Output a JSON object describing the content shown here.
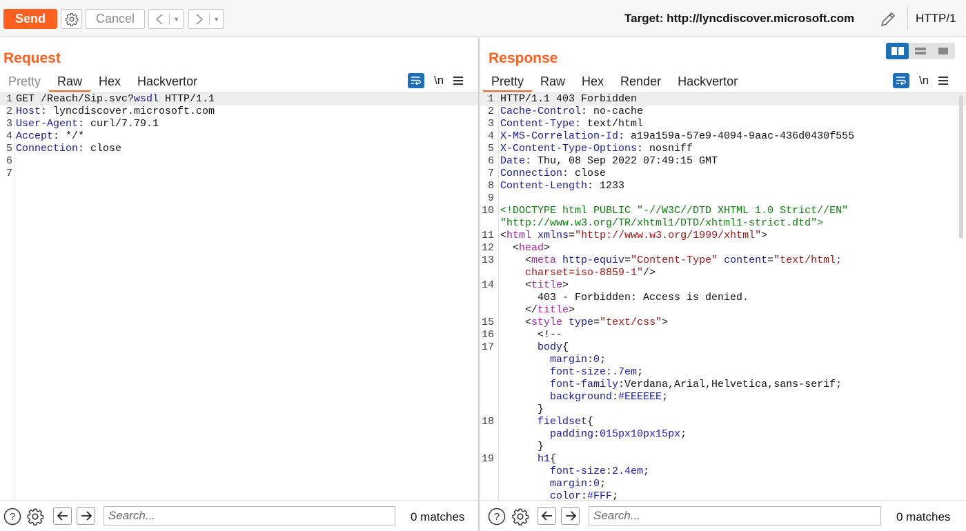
{
  "toolbar": {
    "send_label": "Send",
    "cancel_label": "Cancel",
    "target_label": "Target: http://lyncdiscover.microsoft.com",
    "protocol_label": "HTTP/1"
  },
  "request": {
    "title": "Request",
    "tabs": [
      "Pretty",
      "Raw",
      "Hex",
      "Hackvertor"
    ],
    "active_tab": "Raw",
    "newline_label": "\\n",
    "lines": [
      {
        "n": "1",
        "parts": [
          [
            "v",
            "GET /Reach/Sip.svc?"
          ],
          [
            "k",
            "wsdl"
          ],
          [
            "v",
            " HTTP/1.1"
          ]
        ]
      },
      {
        "n": "2",
        "parts": [
          [
            "k",
            "Host"
          ],
          [
            "v",
            ": lyncdiscover.microsoft.com"
          ]
        ]
      },
      {
        "n": "3",
        "parts": [
          [
            "k",
            "User-Agent"
          ],
          [
            "v",
            ": curl/7.79.1"
          ]
        ]
      },
      {
        "n": "4",
        "parts": [
          [
            "k",
            "Accept"
          ],
          [
            "v",
            ": */*"
          ]
        ]
      },
      {
        "n": "5",
        "parts": [
          [
            "k",
            "Connection"
          ],
          [
            "v",
            ": close"
          ]
        ]
      },
      {
        "n": "6",
        "parts": []
      },
      {
        "n": "7",
        "parts": []
      }
    ],
    "search": {
      "placeholder": "Search...",
      "matches": "0 matches"
    }
  },
  "response": {
    "title": "Response",
    "tabs": [
      "Pretty",
      "Raw",
      "Hex",
      "Render",
      "Hackvertor"
    ],
    "active_tab": "Pretty",
    "newline_label": "\\n",
    "lines": [
      {
        "n": "1",
        "parts": [
          [
            "v",
            "HTTP/1.1 403 Forbidden"
          ]
        ]
      },
      {
        "n": "2",
        "parts": [
          [
            "k",
            "Cache-Control"
          ],
          [
            "v",
            ": no-cache"
          ]
        ]
      },
      {
        "n": "3",
        "parts": [
          [
            "k",
            "Content-Type"
          ],
          [
            "v",
            ": text/html"
          ]
        ]
      },
      {
        "n": "4",
        "parts": [
          [
            "k",
            "X-MS-Correlation-Id"
          ],
          [
            "v",
            ": a19a159a-57e9-4094-9aac-436d0430f555"
          ]
        ]
      },
      {
        "n": "5",
        "parts": [
          [
            "k",
            "X-Content-Type-Options"
          ],
          [
            "v",
            ": nosniff"
          ]
        ]
      },
      {
        "n": "6",
        "parts": [
          [
            "k",
            "Date"
          ],
          [
            "v",
            ": Thu, 08 Sep 2022 07:49:15 GMT"
          ]
        ]
      },
      {
        "n": "7",
        "parts": [
          [
            "k",
            "Connection"
          ],
          [
            "v",
            ": close"
          ]
        ]
      },
      {
        "n": "8",
        "parts": [
          [
            "k",
            "Content-Length"
          ],
          [
            "v",
            ": 1233"
          ]
        ]
      },
      {
        "n": "9",
        "parts": []
      },
      {
        "n": "10",
        "parts": [
          [
            "doctype",
            "<!DOCTYPE html PUBLIC \"-//W3C//DTD XHTML 1.0 Strict//EN\""
          ]
        ]
      },
      {
        "n": "",
        "parts": [
          [
            "doctype",
            "\"http://www.w3.org/TR/xhtml1/DTD/xhtml1-strict.dtd\">"
          ]
        ]
      },
      {
        "n": "11",
        "parts": [
          [
            "tagp",
            "<"
          ],
          [
            "tag",
            "html"
          ],
          [
            "tagp",
            " "
          ],
          [
            "attr",
            "xmlns"
          ],
          [
            "tagp",
            "="
          ],
          [
            "str",
            "\"http://www.w3.org/1999/xhtml\""
          ],
          [
            "tagp",
            ">"
          ]
        ]
      },
      {
        "n": "12",
        "parts": [
          [
            "tagp",
            "  <"
          ],
          [
            "tag",
            "head"
          ],
          [
            "tagp",
            ">"
          ]
        ]
      },
      {
        "n": "13",
        "parts": [
          [
            "tagp",
            "    <"
          ],
          [
            "tag",
            "meta"
          ],
          [
            "tagp",
            " "
          ],
          [
            "attr",
            "http-equiv"
          ],
          [
            "tagp",
            "="
          ],
          [
            "str",
            "\"Content-Type\""
          ],
          [
            "tagp",
            " "
          ],
          [
            "attr",
            "content"
          ],
          [
            "tagp",
            "="
          ],
          [
            "str",
            "\"text/html;"
          ]
        ]
      },
      {
        "n": "",
        "parts": [
          [
            "str",
            "    charset=iso-8859-1\""
          ],
          [
            "tagp",
            "/>"
          ]
        ]
      },
      {
        "n": "14",
        "parts": [
          [
            "tagp",
            "    <"
          ],
          [
            "tag",
            "title"
          ],
          [
            "tagp",
            ">"
          ]
        ]
      },
      {
        "n": "",
        "parts": [
          [
            "v",
            "      403 - Forbidden: Access is denied."
          ]
        ]
      },
      {
        "n": "",
        "parts": [
          [
            "tagp",
            "    </"
          ],
          [
            "tag",
            "title"
          ],
          [
            "tagp",
            ">"
          ]
        ]
      },
      {
        "n": "15",
        "parts": [
          [
            "tagp",
            "    <"
          ],
          [
            "tag",
            "style"
          ],
          [
            "tagp",
            " "
          ],
          [
            "attr",
            "type"
          ],
          [
            "tagp",
            "="
          ],
          [
            "str",
            "\"text/css\""
          ],
          [
            "tagp",
            ">"
          ]
        ]
      },
      {
        "n": "16",
        "parts": [
          [
            "v",
            "      <!--"
          ]
        ]
      },
      {
        "n": "17",
        "parts": [
          [
            "css-sel",
            "      body"
          ],
          [
            "v",
            "{"
          ]
        ]
      },
      {
        "n": "",
        "parts": [
          [
            "css-prop",
            "        margin"
          ],
          [
            "v",
            ":"
          ],
          [
            "css-val",
            "0"
          ],
          [
            "v",
            ";"
          ]
        ]
      },
      {
        "n": "",
        "parts": [
          [
            "css-prop",
            "        font-size"
          ],
          [
            "v",
            ":"
          ],
          [
            "css-val",
            ".7em"
          ],
          [
            "v",
            ";"
          ]
        ]
      },
      {
        "n": "",
        "parts": [
          [
            "css-prop",
            "        font-family"
          ],
          [
            "v",
            ":Verdana,Arial,Helvetica,sans-serif;"
          ]
        ]
      },
      {
        "n": "",
        "parts": [
          [
            "css-prop",
            "        background"
          ],
          [
            "v",
            ":"
          ],
          [
            "css-col",
            "#EEEEEE"
          ],
          [
            "v",
            ";"
          ]
        ]
      },
      {
        "n": "",
        "parts": [
          [
            "v",
            "      }"
          ]
        ]
      },
      {
        "n": "18",
        "parts": [
          [
            "css-sel",
            "      fieldset"
          ],
          [
            "v",
            "{"
          ]
        ]
      },
      {
        "n": "",
        "parts": [
          [
            "css-prop",
            "        padding"
          ],
          [
            "v",
            ":"
          ],
          [
            "css-val",
            "015px10px15px"
          ],
          [
            "v",
            ";"
          ]
        ]
      },
      {
        "n": "",
        "parts": [
          [
            "v",
            "      }"
          ]
        ]
      },
      {
        "n": "19",
        "parts": [
          [
            "css-sel",
            "      h1"
          ],
          [
            "v",
            "{"
          ]
        ]
      },
      {
        "n": "",
        "parts": [
          [
            "css-prop",
            "        font-size"
          ],
          [
            "v",
            ":"
          ],
          [
            "css-val",
            "2.4em"
          ],
          [
            "v",
            ";"
          ]
        ]
      },
      {
        "n": "",
        "parts": [
          [
            "css-prop",
            "        margin"
          ],
          [
            "v",
            ":"
          ],
          [
            "css-val",
            "0"
          ],
          [
            "v",
            ";"
          ]
        ]
      },
      {
        "n": "",
        "parts": [
          [
            "css-prop",
            "        color"
          ],
          [
            "v",
            ":"
          ],
          [
            "css-col",
            "#FFF"
          ],
          [
            "v",
            ";"
          ]
        ]
      }
    ],
    "search": {
      "placeholder": "Search...",
      "matches": "0 matches"
    }
  },
  "icons": {
    "settings": "gear-icon",
    "help": "help-icon",
    "edit": "pencil-icon",
    "wrap": "wrap-lines-icon",
    "menu": "hamburger-menu-icon"
  },
  "colors": {
    "accent": "#ff5f1f",
    "toggle_blue": "#1f6fb5"
  }
}
